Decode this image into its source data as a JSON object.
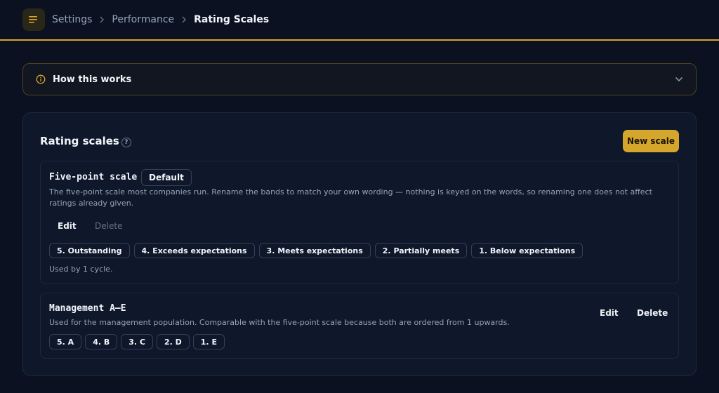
{
  "breadcrumb": [
    "Settings",
    "Performance",
    "Rating Scales"
  ],
  "howto": {
    "title": "How this works"
  },
  "panel": {
    "title": "Rating scales",
    "help": "?",
    "new_button": "New scale"
  },
  "scales": [
    {
      "name": "Five-point scale",
      "badge": "Default",
      "description": "The five-point scale most companies run. Rename the bands to match your own wording — nothing is keyed on the words, so renaming one does not affect ratings already given.",
      "edit": "Edit",
      "delete": "Delete",
      "delete_disabled": true,
      "bands": [
        "5. Outstanding",
        "4. Exceeds expectations",
        "3. Meets expectations",
        "2. Partially meets",
        "1. Below expectations"
      ],
      "usage": "Used by 1 cycle."
    },
    {
      "name": "Management A–E",
      "description": "Used for the management population. Comparable with the five-point scale because both are ordered from 1 upwards.",
      "edit": "Edit",
      "delete": "Delete",
      "delete_disabled": false,
      "bands": [
        "5. A",
        "4. B",
        "3. C",
        "2. D",
        "1. E"
      ]
    }
  ],
  "colors": {
    "accent": "#d4a72c",
    "background": "#0b1120",
    "panel": "#0f172a"
  },
  "icons": {
    "menu": "menu-icon",
    "breadcrumb_separator": "chevron-right-icon",
    "info": "info-icon",
    "expand": "chevron-down-icon"
  }
}
